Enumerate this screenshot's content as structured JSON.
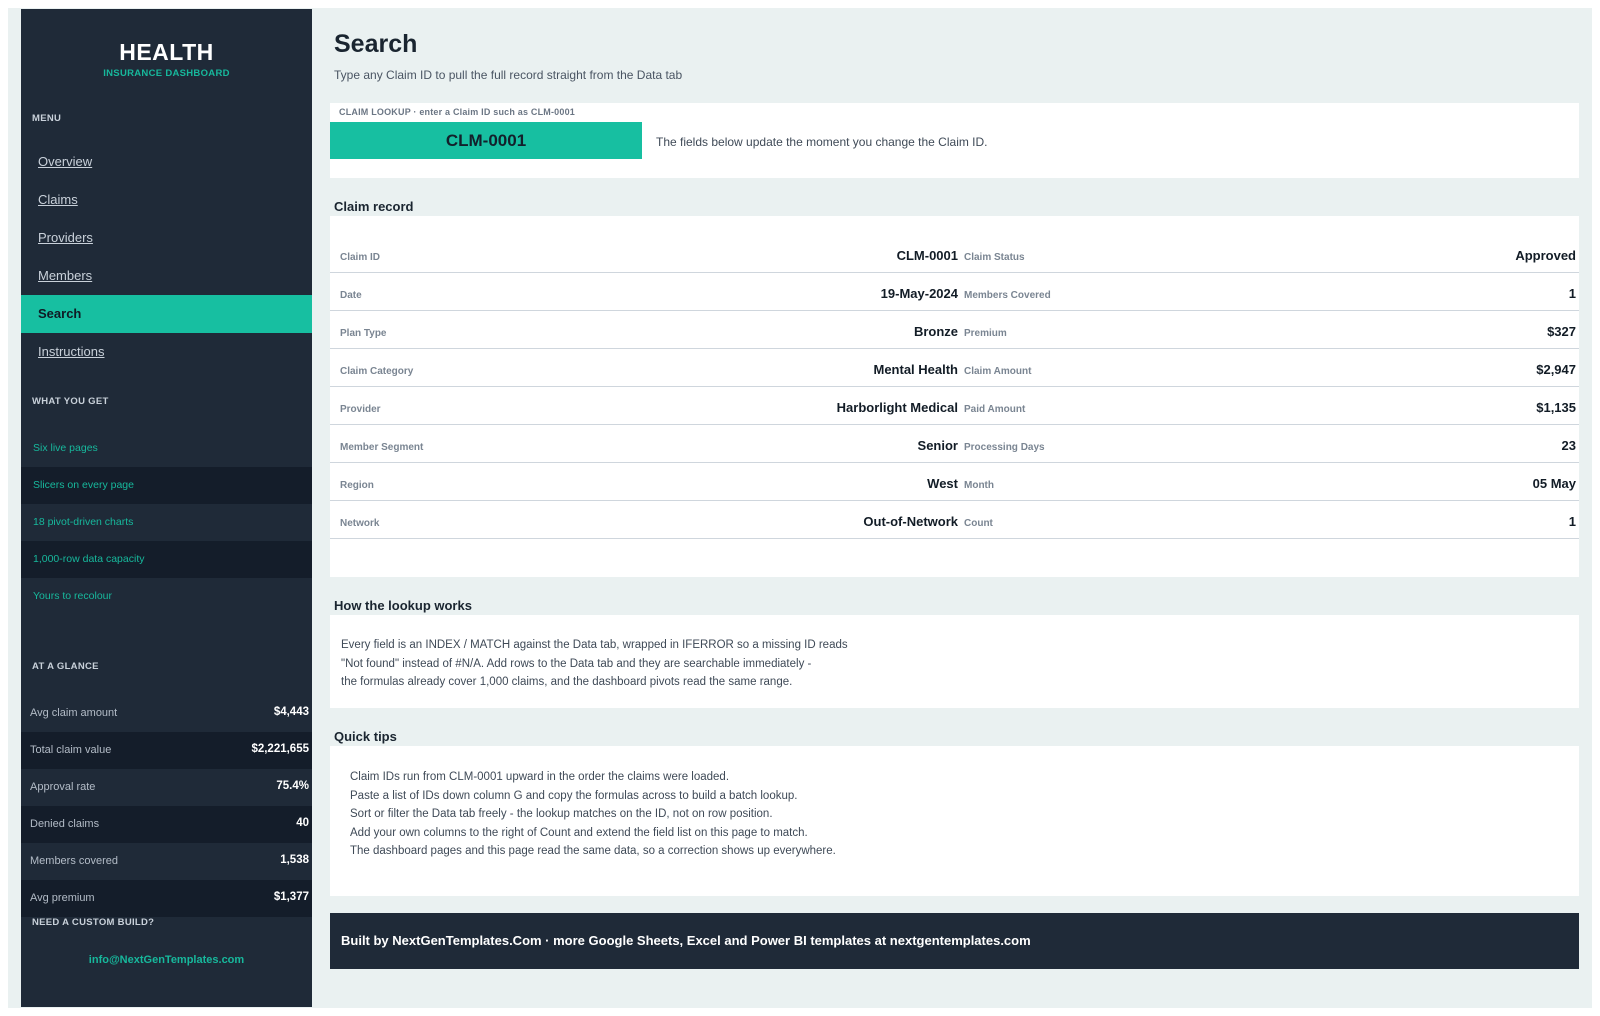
{
  "brand": {
    "title": "HEALTH",
    "subtitle": "INSURANCE DASHBOARD"
  },
  "sidebar": {
    "menu_label": "MENU",
    "menu": [
      {
        "label": "Overview"
      },
      {
        "label": "Claims"
      },
      {
        "label": "Providers"
      },
      {
        "label": "Members"
      },
      {
        "label": "Search",
        "active": true
      },
      {
        "label": "Instructions"
      }
    ],
    "features_label": "WHAT YOU GET",
    "features": [
      "Six live pages",
      "Slicers on every page",
      "18 pivot-driven charts",
      "1,000-row data capacity",
      "Yours to recolour"
    ],
    "glance_label": "AT A GLANCE",
    "glance": [
      {
        "label": "Avg claim amount",
        "value": "$4,443"
      },
      {
        "label": "Total claim value",
        "value": "$2,221,655"
      },
      {
        "label": "Approval rate",
        "value": "75.4%"
      },
      {
        "label": "Denied claims",
        "value": "40"
      },
      {
        "label": "Members covered",
        "value": "1,538"
      },
      {
        "label": "Avg premium",
        "value": "$1,377"
      }
    ],
    "custom_label": "NEED A CUSTOM BUILD?",
    "email": "info@NextGenTemplates.com"
  },
  "page": {
    "title": "Search",
    "subtitle": "Type any Claim ID to pull the full record straight from the Data tab"
  },
  "lookup": {
    "label": "CLAIM LOOKUP  ·  enter a Claim ID such as CLM-0001",
    "value": "CLM-0001",
    "note": "The fields below update the moment you change the Claim ID."
  },
  "record": {
    "title": "Claim record",
    "rows": [
      {
        "lk": "Claim ID",
        "lv": "CLM-0001",
        "rk": "Claim Status",
        "rv": "Approved"
      },
      {
        "lk": "Date",
        "lv": "19-May-2024",
        "rk": "Members Covered",
        "rv": "1"
      },
      {
        "lk": "Plan Type",
        "lv": "Bronze",
        "rk": "Premium",
        "rv": "$327"
      },
      {
        "lk": "Claim Category",
        "lv": "Mental Health",
        "rk": "Claim Amount",
        "rv": "$2,947"
      },
      {
        "lk": "Provider",
        "lv": "Harborlight Medical",
        "rk": "Paid Amount",
        "rv": "$1,135"
      },
      {
        "lk": "Member Segment",
        "lv": "Senior",
        "rk": "Processing Days",
        "rv": "23"
      },
      {
        "lk": "Region",
        "lv": "West",
        "rk": "Month",
        "rv": "05 May"
      },
      {
        "lk": "Network",
        "lv": "Out-of-Network",
        "rk": "Count",
        "rv": "1"
      }
    ]
  },
  "how": {
    "title": "How the lookup works",
    "lines": [
      "Every field is an INDEX / MATCH against the Data tab, wrapped in IFERROR so a missing ID reads",
      "\"Not found\" instead of #N/A. Add rows to the Data tab and they are searchable immediately -",
      "the formulas already cover 1,000 claims, and the dashboard pivots read the same range."
    ]
  },
  "tips": {
    "title": "Quick tips",
    "lines": [
      "Claim IDs run from CLM-0001 upward in the order the claims were loaded.",
      "Paste a list of IDs down column G and copy the formulas across to build a batch lookup.",
      "Sort or filter the Data tab freely - the lookup matches on the ID, not on row position.",
      "Add your own columns to the right of Count and extend the field list on this page to match.",
      "The dashboard pages and this page read the same data, so a correction shows up everywhere."
    ]
  },
  "footer": {
    "text": "Built by NextGenTemplates.Com  ·  more Google Sheets, Excel and Power BI templates at nextgentemplates.com"
  },
  "colors": {
    "accent": "#17bfa1",
    "sidebar": "#1f2a38",
    "background": "#eaf1f1"
  }
}
